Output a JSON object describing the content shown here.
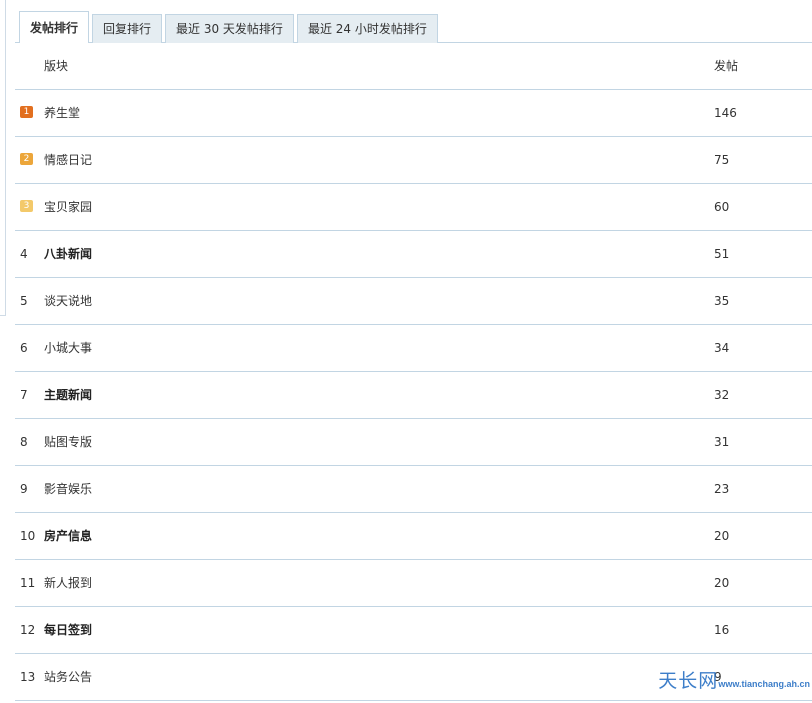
{
  "tabs": [
    {
      "label": "发帖排行",
      "active": true
    },
    {
      "label": "回复排行",
      "active": false
    },
    {
      "label": "最近 30 天发帖排行",
      "active": false
    },
    {
      "label": "最近 24 小时发帖排行",
      "active": false
    }
  ],
  "table": {
    "headers": {
      "forum": "版块",
      "count": "发帖"
    },
    "rows": [
      {
        "rank": "1",
        "forum": "养生堂",
        "count": "146",
        "bold": false
      },
      {
        "rank": "2",
        "forum": "情感日记",
        "count": "75",
        "bold": false
      },
      {
        "rank": "3",
        "forum": "宝贝家园",
        "count": "60",
        "bold": false
      },
      {
        "rank": "4",
        "forum": "八卦新闻",
        "count": "51",
        "bold": true
      },
      {
        "rank": "5",
        "forum": "谈天说地",
        "count": "35",
        "bold": false
      },
      {
        "rank": "6",
        "forum": "小城大事",
        "count": "34",
        "bold": false
      },
      {
        "rank": "7",
        "forum": "主题新闻",
        "count": "32",
        "bold": true
      },
      {
        "rank": "8",
        "forum": "贴图专版",
        "count": "31",
        "bold": false
      },
      {
        "rank": "9",
        "forum": "影音娱乐",
        "count": "23",
        "bold": false
      },
      {
        "rank": "10",
        "forum": "房产信息",
        "count": "20",
        "bold": true
      },
      {
        "rank": "11",
        "forum": "新人报到",
        "count": "20",
        "bold": false
      },
      {
        "rank": "12",
        "forum": "每日签到",
        "count": "16",
        "bold": true
      },
      {
        "rank": "13",
        "forum": "站务公告",
        "count": "9",
        "bold": false
      }
    ]
  },
  "badge_colors": [
    "#e26f1f",
    "#eca63a",
    "#f3c96a"
  ],
  "watermark": {
    "name": "天长网",
    "url": "www.tianchang.ah.cn"
  }
}
